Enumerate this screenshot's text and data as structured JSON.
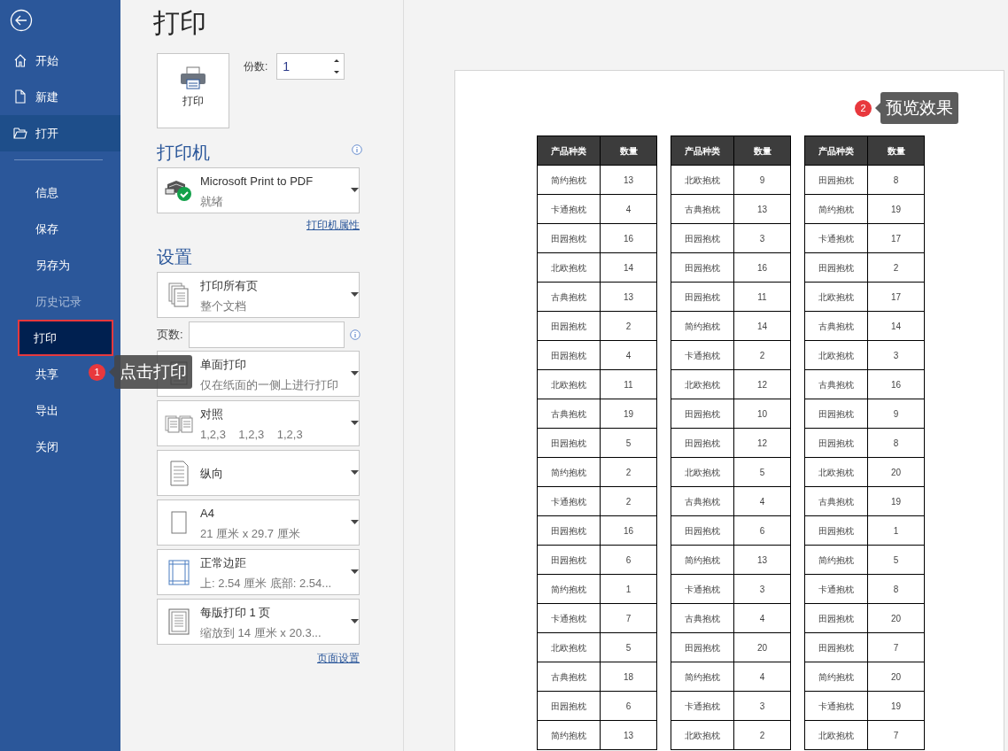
{
  "sidebar": {
    "items": [
      {
        "label": "开始",
        "kind": "icon",
        "selected": false,
        "hovered": false,
        "disabled": false,
        "outlined": false
      },
      {
        "label": "新建",
        "kind": "icon",
        "selected": false,
        "hovered": false,
        "disabled": false,
        "outlined": false
      },
      {
        "label": "打开",
        "kind": "icon",
        "selected": false,
        "hovered": true,
        "disabled": false,
        "outlined": false
      },
      {
        "label": "信息",
        "kind": "text",
        "selected": false,
        "hovered": false,
        "disabled": false,
        "outlined": false
      },
      {
        "label": "保存",
        "kind": "text",
        "selected": false,
        "hovered": false,
        "disabled": false,
        "outlined": false
      },
      {
        "label": "另存为",
        "kind": "text",
        "selected": false,
        "hovered": false,
        "disabled": false,
        "outlined": false
      },
      {
        "label": "历史记录",
        "kind": "text",
        "selected": false,
        "hovered": false,
        "disabled": true,
        "outlined": false
      },
      {
        "label": "打印",
        "kind": "text",
        "selected": true,
        "hovered": false,
        "disabled": false,
        "outlined": true
      },
      {
        "label": "共享",
        "kind": "text",
        "selected": false,
        "hovered": false,
        "disabled": false,
        "outlined": false
      },
      {
        "label": "导出",
        "kind": "text",
        "selected": false,
        "hovered": false,
        "disabled": false,
        "outlined": false
      },
      {
        "label": "关闭",
        "kind": "text",
        "selected": false,
        "hovered": false,
        "disabled": false,
        "outlined": false
      }
    ]
  },
  "page_title": "打印",
  "print_button": {
    "label": "打印"
  },
  "copies": {
    "label": "份数:",
    "value": "1"
  },
  "printer": {
    "heading": "打印机",
    "name": "Microsoft Print to PDF",
    "status": "就绪",
    "properties_link": "打印机属性"
  },
  "settings": {
    "heading": "设置",
    "dropdowns": [
      {
        "title": "打印所有页",
        "subtitle": "整个文档"
      },
      {
        "title": "单面打印",
        "subtitle": "仅在纸面的一侧上进行打印"
      },
      {
        "title": "对照",
        "subtitle": "1,2,3    1,2,3    1,2,3"
      },
      {
        "title": "纵向"
      },
      {
        "title": "A4",
        "subtitle": "21 厘米 x 29.7 厘米"
      },
      {
        "title": "正常边距",
        "subtitle": "上: 2.54 厘米 底部: 2.54..."
      },
      {
        "title": "每版打印 1 页",
        "subtitle": "缩放到 14 厘米 x 20.3..."
      }
    ],
    "pages": {
      "label": "页数:"
    },
    "page_setup_link": "页面设置"
  },
  "preview": {
    "tables": [
      {
        "columns": [
          "产品种类",
          "数量"
        ],
        "rows": [
          [
            "简约抱枕",
            "13"
          ],
          [
            "卡通抱枕",
            "4"
          ],
          [
            "田园抱枕",
            "16"
          ],
          [
            "北欧抱枕",
            "14"
          ],
          [
            "古典抱枕",
            "13"
          ],
          [
            "田园抱枕",
            "2"
          ],
          [
            "田园抱枕",
            "4"
          ],
          [
            "北欧抱枕",
            "11"
          ],
          [
            "古典抱枕",
            "19"
          ],
          [
            "田园抱枕",
            "5"
          ],
          [
            "简约抱枕",
            "2"
          ],
          [
            "卡通抱枕",
            "2"
          ],
          [
            "田园抱枕",
            "16"
          ],
          [
            "田园抱枕",
            "6"
          ],
          [
            "简约抱枕",
            "1"
          ],
          [
            "卡通抱枕",
            "7"
          ],
          [
            "北欧抱枕",
            "5"
          ],
          [
            "古典抱枕",
            "18"
          ],
          [
            "田园抱枕",
            "6"
          ],
          [
            "简约抱枕",
            "13"
          ]
        ]
      },
      {
        "columns": [
          "产品种类",
          "数量"
        ],
        "rows": [
          [
            "北欧抱枕",
            "9"
          ],
          [
            "古典抱枕",
            "13"
          ],
          [
            "田园抱枕",
            "3"
          ],
          [
            "田园抱枕",
            "16"
          ],
          [
            "田园抱枕",
            "11"
          ],
          [
            "简约抱枕",
            "14"
          ],
          [
            "卡通抱枕",
            "2"
          ],
          [
            "北欧抱枕",
            "12"
          ],
          [
            "田园抱枕",
            "10"
          ],
          [
            "田园抱枕",
            "12"
          ],
          [
            "北欧抱枕",
            "5"
          ],
          [
            "古典抱枕",
            "4"
          ],
          [
            "田园抱枕",
            "6"
          ],
          [
            "简约抱枕",
            "13"
          ],
          [
            "卡通抱枕",
            "3"
          ],
          [
            "古典抱枕",
            "4"
          ],
          [
            "田园抱枕",
            "20"
          ],
          [
            "简约抱枕",
            "4"
          ],
          [
            "卡通抱枕",
            "3"
          ],
          [
            "北欧抱枕",
            "2"
          ]
        ]
      },
      {
        "columns": [
          "产品种类",
          "数量"
        ],
        "rows": [
          [
            "田园抱枕",
            "8"
          ],
          [
            "简约抱枕",
            "19"
          ],
          [
            "卡通抱枕",
            "17"
          ],
          [
            "田园抱枕",
            "2"
          ],
          [
            "北欧抱枕",
            "17"
          ],
          [
            "古典抱枕",
            "14"
          ],
          [
            "北欧抱枕",
            "3"
          ],
          [
            "古典抱枕",
            "16"
          ],
          [
            "田园抱枕",
            "9"
          ],
          [
            "田园抱枕",
            "8"
          ],
          [
            "北欧抱枕",
            "20"
          ],
          [
            "古典抱枕",
            "19"
          ],
          [
            "田园抱枕",
            "1"
          ],
          [
            "简约抱枕",
            "5"
          ],
          [
            "卡通抱枕",
            "8"
          ],
          [
            "田园抱枕",
            "20"
          ],
          [
            "田园抱枕",
            "7"
          ],
          [
            "简约抱枕",
            "20"
          ],
          [
            "卡通抱枕",
            "19"
          ],
          [
            "北欧抱枕",
            "7"
          ]
        ]
      }
    ]
  },
  "callouts": [
    {
      "number": "1",
      "text": "点击打印"
    },
    {
      "number": "2",
      "text": "预览效果"
    }
  ]
}
